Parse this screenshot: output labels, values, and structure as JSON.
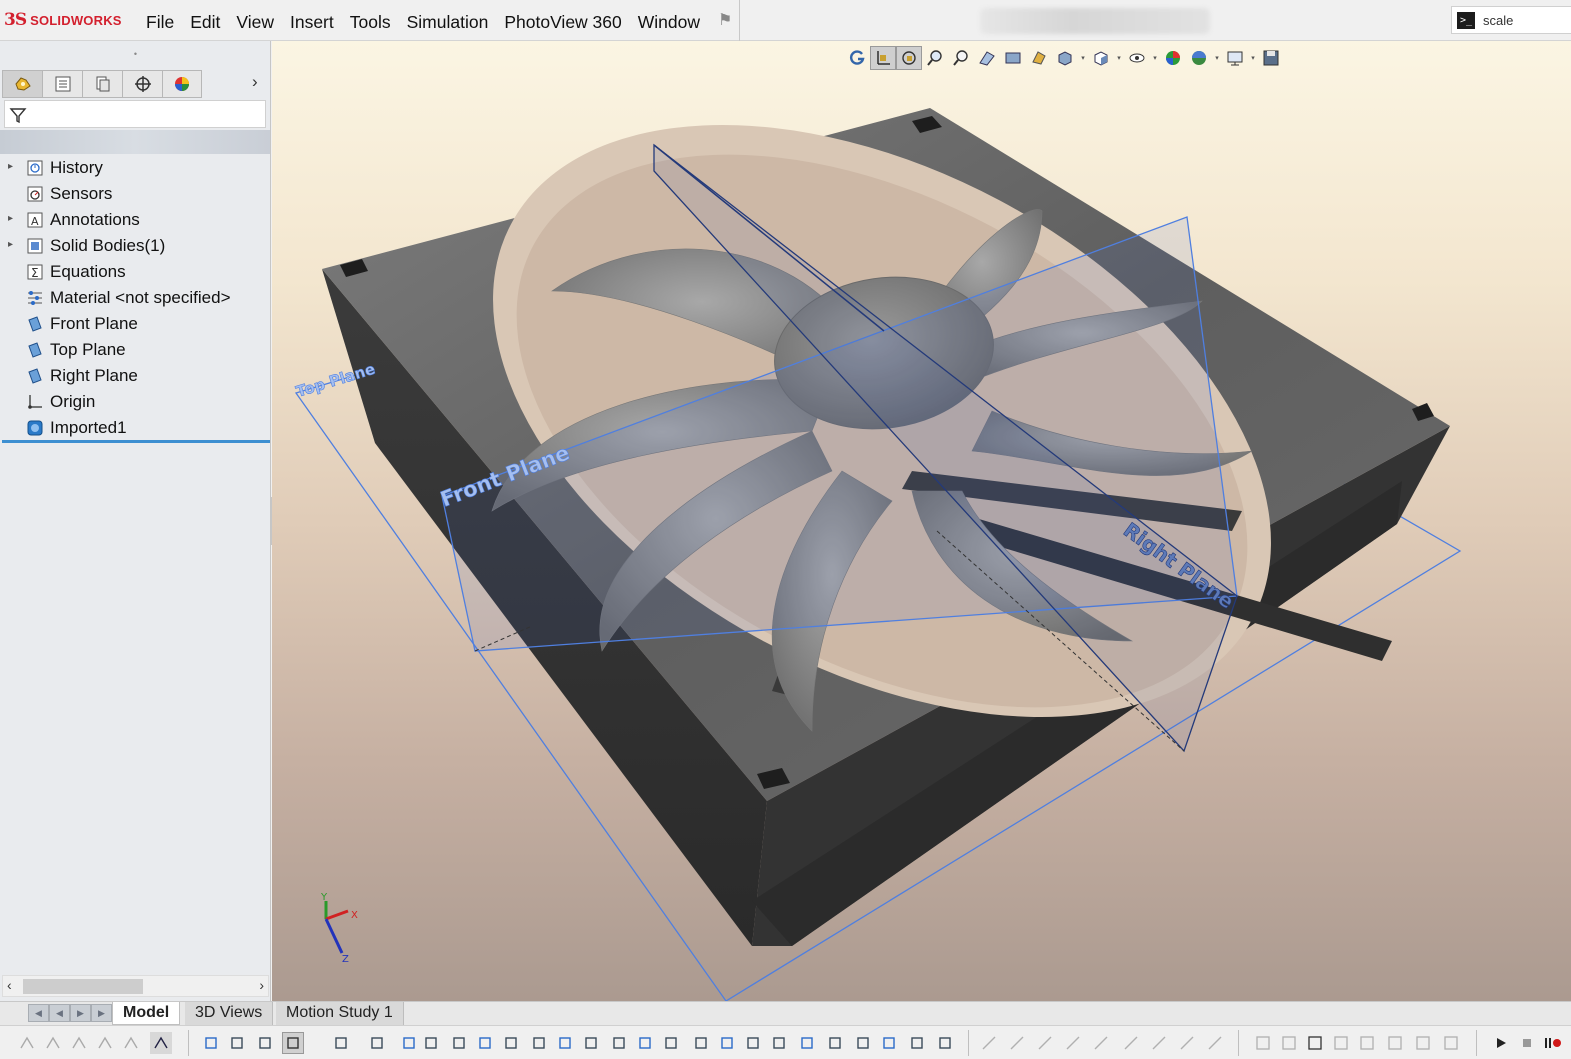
{
  "app": {
    "logo_ds": "3S",
    "logo_text": "SOLIDWORKS"
  },
  "menu": [
    "File",
    "Edit",
    "View",
    "Insert",
    "Tools",
    "Simulation",
    "PhotoView 360",
    "Window"
  ],
  "search": {
    "value": "scale"
  },
  "feature_tree": {
    "items": [
      {
        "label": "History",
        "icon": "history-icon",
        "expandable": true
      },
      {
        "label": "Sensors",
        "icon": "sensors-icon",
        "expandable": false
      },
      {
        "label": "Annotations",
        "icon": "annotations-icon",
        "expandable": true
      },
      {
        "label": "Solid Bodies(1)",
        "icon": "solid-bodies-icon",
        "expandable": true
      },
      {
        "label": "Equations",
        "icon": "equations-icon",
        "expandable": false
      },
      {
        "label": "Material <not specified>",
        "icon": "material-icon",
        "expandable": false
      },
      {
        "label": "Front Plane",
        "icon": "plane-icon",
        "expandable": false
      },
      {
        "label": "Top Plane",
        "icon": "plane-icon",
        "expandable": false
      },
      {
        "label": "Right Plane",
        "icon": "plane-icon",
        "expandable": false
      },
      {
        "label": "Origin",
        "icon": "origin-icon",
        "expandable": false
      },
      {
        "label": "Imported1",
        "icon": "imported-body-icon",
        "expandable": false
      }
    ]
  },
  "panel_tabs": [
    "feature-manager-tab",
    "property-manager-tab",
    "configuration-manager-tab",
    "dimxpert-manager-tab",
    "display-manager-tab"
  ],
  "viewport": {
    "plane_labels": {
      "top": "Top Plane",
      "front": "Front Plane",
      "right": "Right Plane"
    },
    "triad": {
      "x": "X",
      "y": "Y",
      "z": "Z"
    },
    "colors": {
      "plane": "#3a6fd8",
      "model": "#5a5a5a"
    }
  },
  "bottom_tabs": [
    "Model",
    "3D Views",
    "Motion Study 1"
  ],
  "active_bottom_tab": "Model"
}
